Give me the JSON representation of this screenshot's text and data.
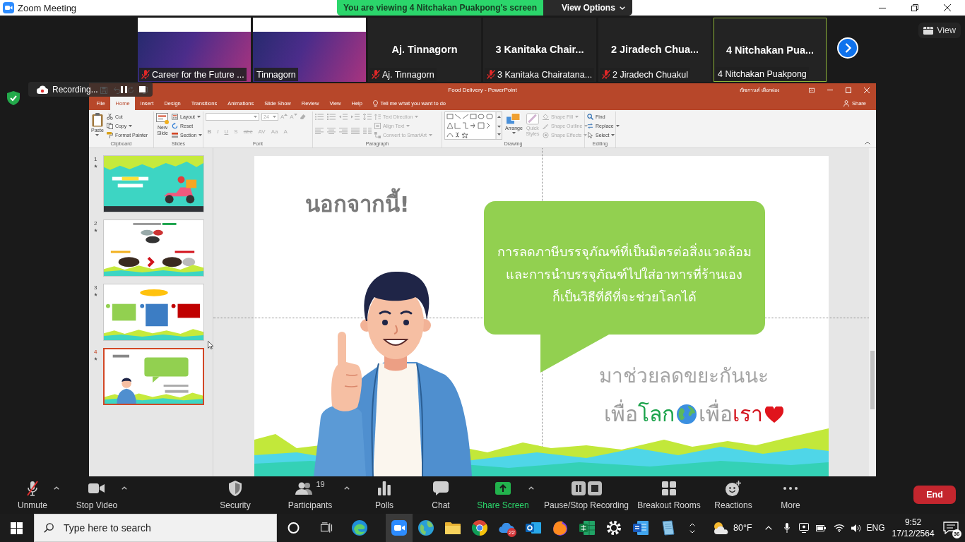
{
  "window": {
    "title": "Zoom Meeting"
  },
  "share_banner": {
    "text": "You are viewing 4 Nitchakan Puakpong's screen",
    "options_label": "View Options"
  },
  "gallery": {
    "tiles": [
      {
        "kind": "video",
        "label": "Career for the Future ...",
        "muted": true,
        "selected": false
      },
      {
        "kind": "video",
        "label": "Tinnagorn",
        "muted": false,
        "selected": false
      },
      {
        "kind": "name",
        "name": "Aj. Tinnagorn",
        "label": "Aj. Tinnagorn",
        "muted": true,
        "selected": false
      },
      {
        "kind": "name",
        "name": "3 Kanitaka Chair...",
        "label": "3 Kanitaka Chairatana...",
        "muted": true,
        "selected": false
      },
      {
        "kind": "name",
        "name": "2 Jiradech Chua...",
        "label": "2 Jiradech Chuakul",
        "muted": true,
        "selected": false
      },
      {
        "kind": "name",
        "name": "4 Nitchakan Pua...",
        "label": "4 Nitchakan Puakpong",
        "muted": false,
        "selected": true
      }
    ],
    "view_label": "View"
  },
  "recording": {
    "label": "Recording..."
  },
  "powerpoint": {
    "title": "Food Delivery - PowerPoint",
    "user": "ณิชกานต์ เผือกผ่อง",
    "tabs": [
      {
        "label": "File",
        "selected": false
      },
      {
        "label": "Home",
        "selected": true
      },
      {
        "label": "Insert",
        "selected": false
      },
      {
        "label": "Design",
        "selected": false
      },
      {
        "label": "Transitions",
        "selected": false
      },
      {
        "label": "Animations",
        "selected": false
      },
      {
        "label": "Slide Show",
        "selected": false
      },
      {
        "label": "Review",
        "selected": false
      },
      {
        "label": "View",
        "selected": false
      },
      {
        "label": "Help",
        "selected": false
      }
    ],
    "tell_me": "Tell me what you want to do",
    "share": "Share",
    "ribbon": {
      "clipboard": {
        "label": "Clipboard",
        "paste": {
          "label": "Paste",
          "disabled": false
        },
        "cut": {
          "label": "Cut",
          "disabled": false
        },
        "copy": {
          "label": "Copy",
          "disabled": false
        },
        "format_painter": {
          "label": "Format Painter",
          "disabled": false
        }
      },
      "slides": {
        "label": "Slides",
        "new_slide": {
          "label": "New Slide",
          "disabled": false
        },
        "layout": {
          "label": "Layout",
          "disabled": false
        },
        "reset": {
          "label": "Reset",
          "disabled": false
        },
        "section": {
          "label": "Section",
          "disabled": false
        }
      },
      "font": {
        "label": "Font",
        "size": "24",
        "grow": "A",
        "shrink": "A",
        "styles": [
          "B",
          "I",
          "U",
          "S",
          "abc",
          "AV",
          "Aa",
          "A"
        ],
        "disabled": true
      },
      "paragraph": {
        "label": "Paragraph",
        "disabled": true,
        "text_direction": {
          "label": "Text Direction",
          "disabled": true
        },
        "align_text": {
          "label": "Align Text",
          "disabled": true
        },
        "smartart": {
          "label": "Convert to SmartArt",
          "disabled": true
        }
      },
      "drawing": {
        "label": "Drawing",
        "arrange": {
          "label": "Arrange",
          "disabled": false
        },
        "quick_styles": {
          "label": "Quick Styles",
          "disabled": true
        },
        "shape_fill": {
          "label": "Shape Fill",
          "disabled": true
        },
        "shape_outline": {
          "label": "Shape Outline",
          "disabled": true
        },
        "shape_effects": {
          "label": "Shape Effects",
          "disabled": true
        }
      },
      "editing": {
        "label": "Editing",
        "find": {
          "label": "Find",
          "disabled": false
        },
        "replace": {
          "label": "Replace",
          "disabled": false
        },
        "select": {
          "label": "Select",
          "disabled": false
        }
      }
    },
    "slides": [
      {
        "number": "1",
        "selected": false
      },
      {
        "number": "2",
        "selected": false
      },
      {
        "number": "3",
        "selected": false
      },
      {
        "number": "4",
        "selected": true
      }
    ],
    "slide": {
      "heading": "นอกจากนี้!",
      "bubble": [
        "การลดภาษีบรรจุภัณฑ์ที่เป็นมิตรต่อสิ่งแวดล้อม",
        "และการนำบรรจุภัณฑ์ไปใส่อาหารที่ร้านเอง",
        "ก็เป็นวิธีที่ดีที่จะช่วยโลกได้"
      ],
      "call": "มาช่วยลดขยะกันนะ",
      "slogan": [
        {
          "text": "เพื่อ",
          "highlight": "โลก",
          "color": "#1ba34b"
        },
        {
          "text": "เพื่อ",
          "highlight": "เรา",
          "color": "#d3121c"
        }
      ]
    }
  },
  "toolbar": {
    "controls": [
      {
        "kind": "mic",
        "label": "Unmute",
        "muted": true,
        "caret": true
      },
      {
        "kind": "camera",
        "label": "Stop Video",
        "caret": true
      },
      {
        "kind": "shield",
        "label": "Security",
        "caret": false
      },
      {
        "kind": "people",
        "label": "Participants",
        "count": "19",
        "caret": true
      },
      {
        "kind": "chart",
        "label": "Polls",
        "caret": false
      },
      {
        "kind": "chat",
        "label": "Chat",
        "caret": false
      },
      {
        "kind": "share",
        "label": "Share Screen",
        "caret": true
      },
      {
        "kind": "recording",
        "label": "Pause/Stop Recording",
        "caret": false
      },
      {
        "kind": "rooms",
        "label": "Breakout Rooms",
        "caret": false
      },
      {
        "kind": "reactions",
        "label": "Reactions",
        "caret": false
      },
      {
        "kind": "more",
        "label": "More",
        "caret": false
      }
    ],
    "end": "End"
  },
  "taskbar": {
    "search": {
      "placeholder": "Type here to search"
    },
    "apps": [
      {
        "kind": "ring",
        "selected": false
      },
      {
        "kind": "task-view",
        "selected": false
      },
      {
        "kind": "swirl",
        "selected": false
      },
      {
        "kind": "camera",
        "selected": true
      },
      {
        "kind": "globe",
        "selected": false
      },
      {
        "kind": "folder",
        "selected": false
      },
      {
        "kind": "wheel",
        "selected": false
      },
      {
        "kind": "cloud",
        "selected": false,
        "badge": "22"
      },
      {
        "kind": "envelope",
        "selected": false
      },
      {
        "kind": "flame",
        "selected": false
      },
      {
        "kind": "sheet",
        "selected": false
      },
      {
        "kind": "gear",
        "selected": false
      },
      {
        "kind": "doc",
        "selected": false
      },
      {
        "kind": "notebook",
        "selected": false
      }
    ],
    "weather": "80°F",
    "language": "ENG",
    "time": "9:52",
    "date": "17/12/2564",
    "notifications": "36"
  }
}
